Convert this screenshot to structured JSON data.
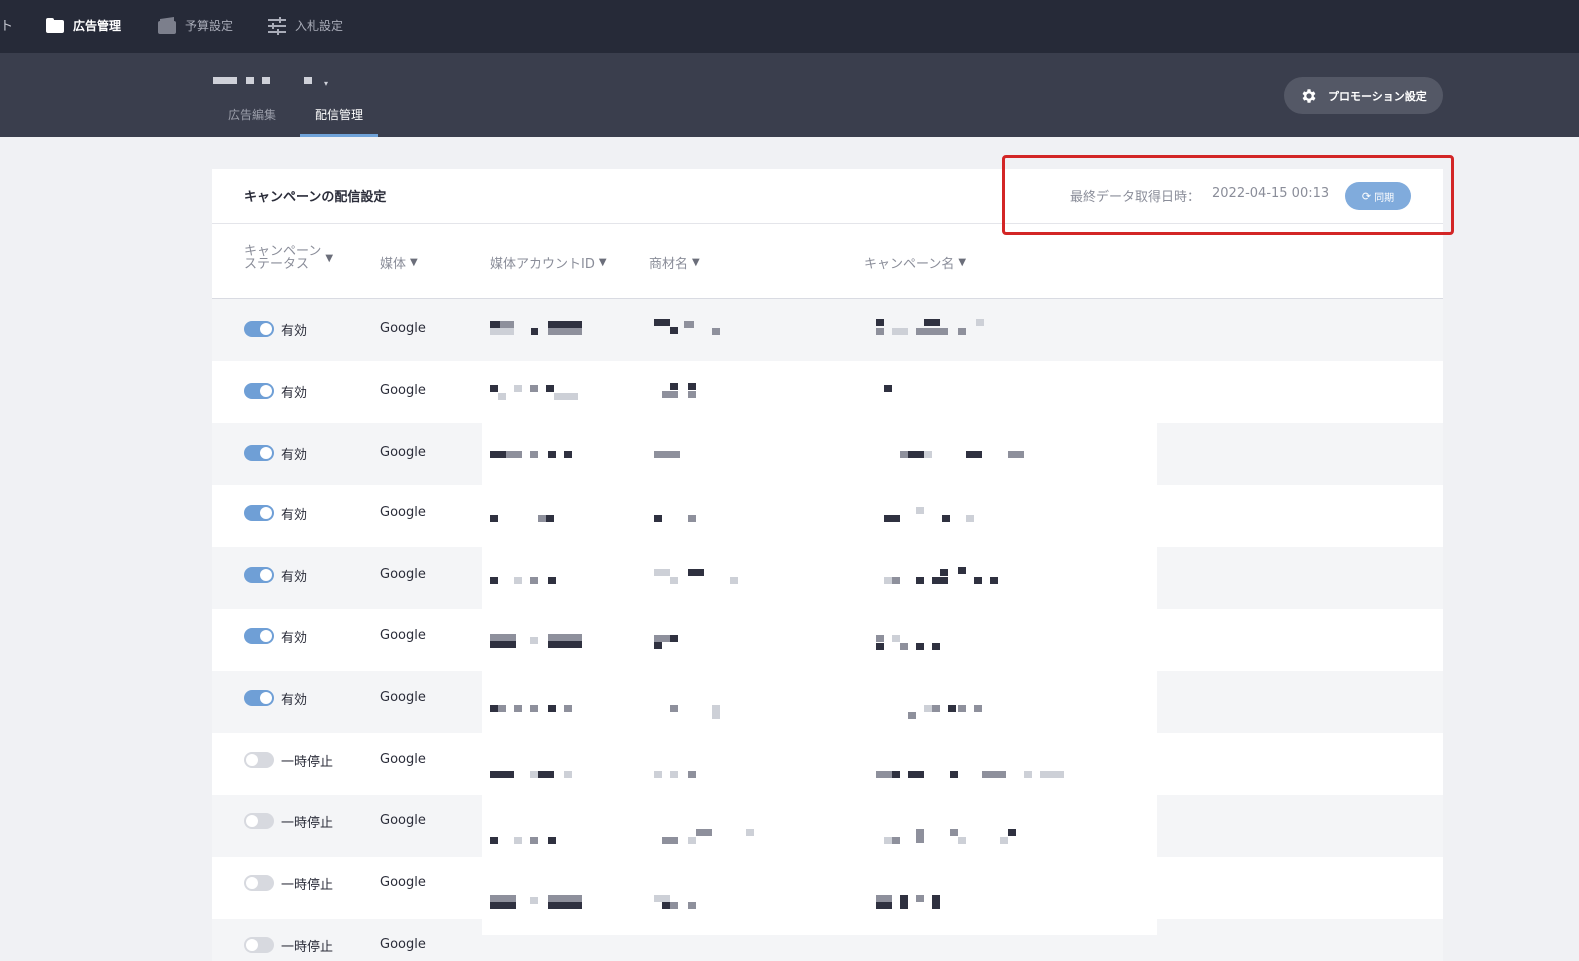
{
  "topnav": {
    "edge_text": "ト",
    "items": [
      {
        "label": "広告管理",
        "icon": "folder-icon",
        "active": true
      },
      {
        "label": "予算設定",
        "icon": "wallet-icon",
        "active": false
      },
      {
        "label": "入札設定",
        "icon": "sliders-icon",
        "active": false
      }
    ]
  },
  "subheader": {
    "account_caret": "▾",
    "tabs": [
      {
        "label": "広告編集",
        "active": false
      },
      {
        "label": "配信管理",
        "active": true
      }
    ],
    "promotion_button": {
      "label": "プロモーション設定",
      "icon": "gear-icon"
    }
  },
  "card": {
    "title": "キャンペーンの配信設定",
    "last_fetch_label": "最終データ取得日時：",
    "last_fetch_value": "2022-04-15 00:13",
    "sync_button": {
      "label": "同期",
      "icon": "sync-icon"
    },
    "columns": [
      {
        "label": "キャンペーン\nステータス",
        "filter_icon": "filter-icon"
      },
      {
        "label": "媒体",
        "filter_icon": "filter-icon"
      },
      {
        "label": "媒体アカウントID",
        "filter_icon": "filter-icon"
      },
      {
        "label": "商材名",
        "filter_icon": "filter-icon"
      },
      {
        "label": "キャンペーン名",
        "filter_icon": "filter-icon"
      }
    ],
    "filter_glyph": "▼",
    "rows": [
      {
        "status": "有効",
        "enabled": true,
        "media": "Google"
      },
      {
        "status": "有効",
        "enabled": true,
        "media": "Google"
      },
      {
        "status": "有効",
        "enabled": true,
        "media": "Google"
      },
      {
        "status": "有効",
        "enabled": true,
        "media": "Google"
      },
      {
        "status": "有効",
        "enabled": true,
        "media": "Google"
      },
      {
        "status": "有効",
        "enabled": true,
        "media": "Google"
      },
      {
        "status": "有効",
        "enabled": true,
        "media": "Google"
      },
      {
        "status": "一時停止",
        "enabled": false,
        "media": "Google"
      },
      {
        "status": "一時停止",
        "enabled": false,
        "media": "Google"
      },
      {
        "status": "一時停止",
        "enabled": false,
        "media": "Google"
      },
      {
        "status": "一時停止",
        "enabled": false,
        "media": "Google"
      }
    ]
  },
  "colors": {
    "nav_bg": "#262a38",
    "subheader_bg": "#3a3e4d",
    "accent": "#6f9fd6",
    "highlight": "#d32626"
  }
}
